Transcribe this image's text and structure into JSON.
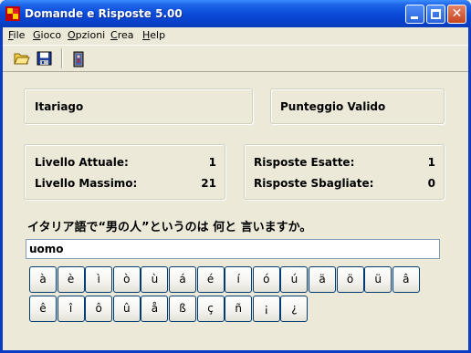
{
  "window": {
    "title": "Domande e Risposte 5.00"
  },
  "menu": [
    {
      "label": "File",
      "underline": "F",
      "rest": "ile"
    },
    {
      "label": "Gioco",
      "underline": "G",
      "rest": "ioco"
    },
    {
      "label": "Opzioni",
      "underline": "O",
      "rest": "pzioni"
    },
    {
      "label": "Crea",
      "underline": "C",
      "rest": "rea"
    },
    {
      "label": "Help",
      "underline": "H",
      "rest": "elp"
    }
  ],
  "toolbar": {
    "icons": [
      "open-folder-icon",
      "save-disk-icon",
      "exit-door-icon"
    ]
  },
  "panels": {
    "language": "Itariago",
    "score_mode": "Punteggio Valido",
    "current_level_label": "Livello Attuale:",
    "current_level": "1",
    "max_level_label": "Livello Massimo:",
    "max_level": "21",
    "correct_label": "Risposte Esatte:",
    "correct": "1",
    "wrong_label": "Risposte Sbagliate:",
    "wrong": "0"
  },
  "question": "イタリア語で“男の人”というのは 何と 言いますか。",
  "answer": {
    "value": "uomo"
  },
  "keys_row1": [
    "à",
    "è",
    "ì",
    "ò",
    "ù",
    "á",
    "é",
    "í",
    "ó",
    "ú",
    "ä",
    "ö",
    "ü",
    "â"
  ],
  "keys_row2": [
    "ê",
    "î",
    "ô",
    "û",
    "å",
    "ß",
    "ç",
    "ñ",
    "¡",
    "¿"
  ],
  "colors": {
    "titlebar": "#0A4BD8",
    "face": "#ECE9D8",
    "key_border": "#003C74"
  }
}
